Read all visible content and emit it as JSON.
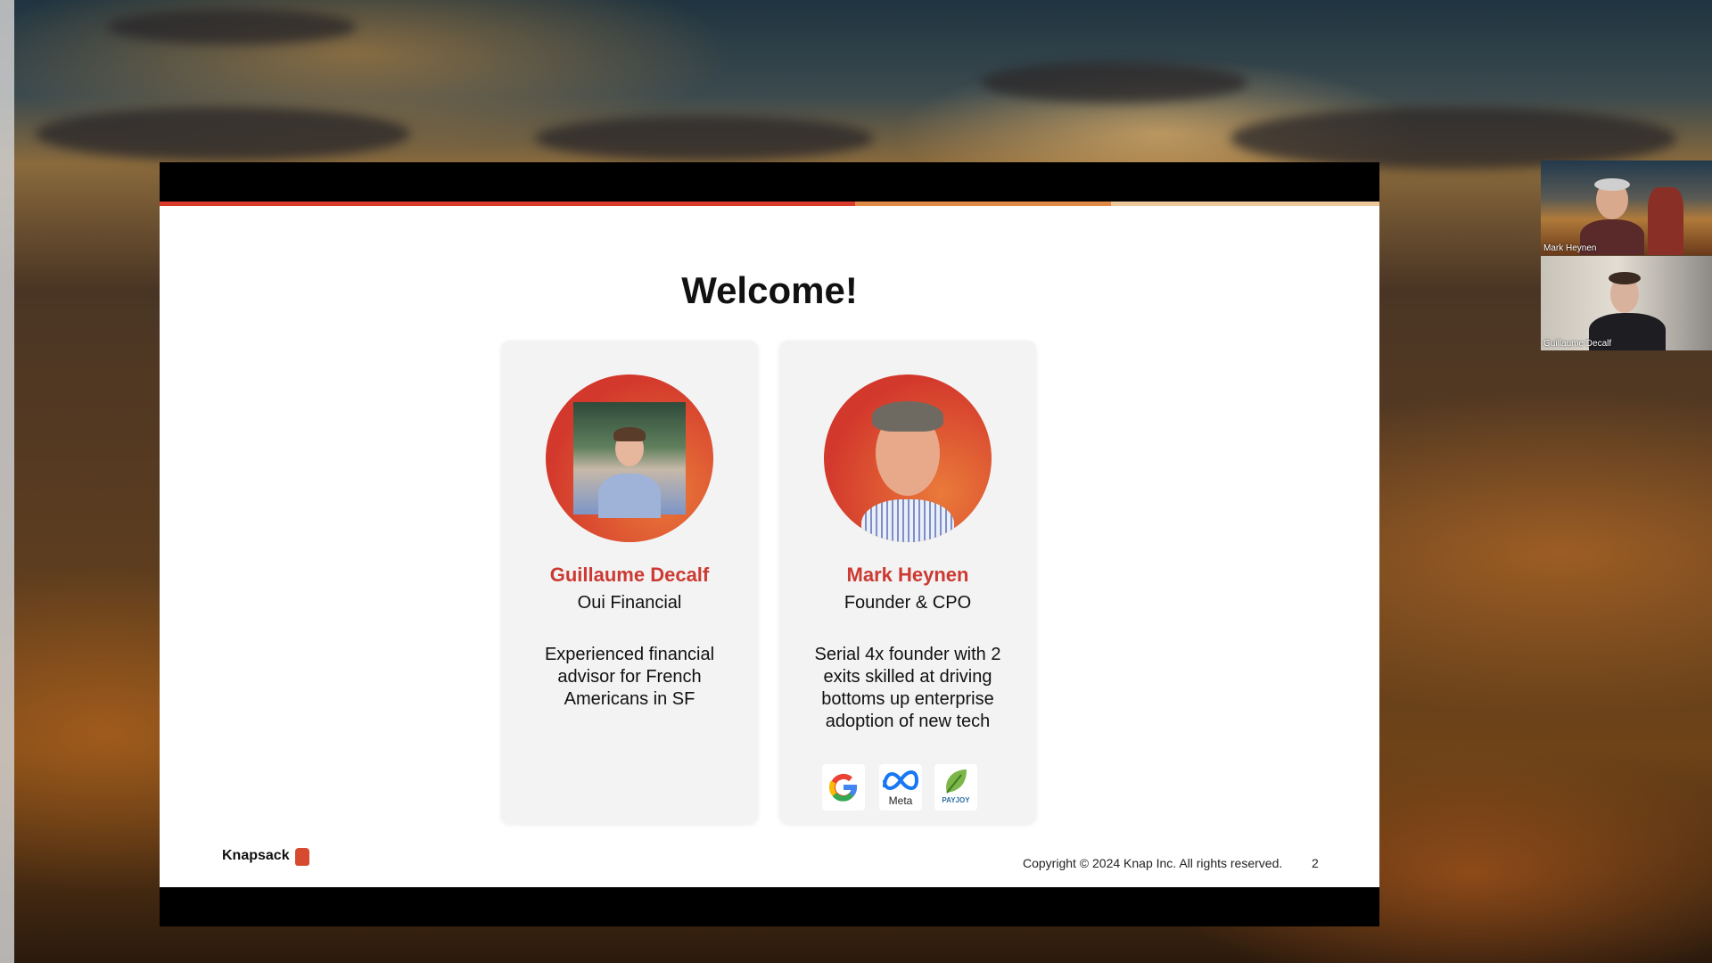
{
  "slide": {
    "title": "Welcome!",
    "brand": "Knapsack",
    "copyright": "Copyright © 2024 Knap Inc. All rights reserved.",
    "page_number": "2"
  },
  "cards": [
    {
      "name": "Guillaume Decalf",
      "role": "Oui Financial",
      "bio": "Experienced financial advisor for French Americans in SF"
    },
    {
      "name": "Mark Heynen",
      "role": "Founder & CPO",
      "bio": "Serial 4x founder with 2 exits skilled at driving bottoms up enterprise adoption of new tech",
      "logos": [
        {
          "icon": "google-logo"
        },
        {
          "icon": "meta-logo",
          "label": "Meta"
        },
        {
          "icon": "payjoy-logo",
          "label": "PAYJOY"
        }
      ]
    }
  ],
  "participants": [
    {
      "name": "Mark Heynen"
    },
    {
      "name": "Guillaume Decalf"
    }
  ],
  "colors": {
    "accent_red": "#cc3a32",
    "accent_orange": "#e08a46"
  }
}
